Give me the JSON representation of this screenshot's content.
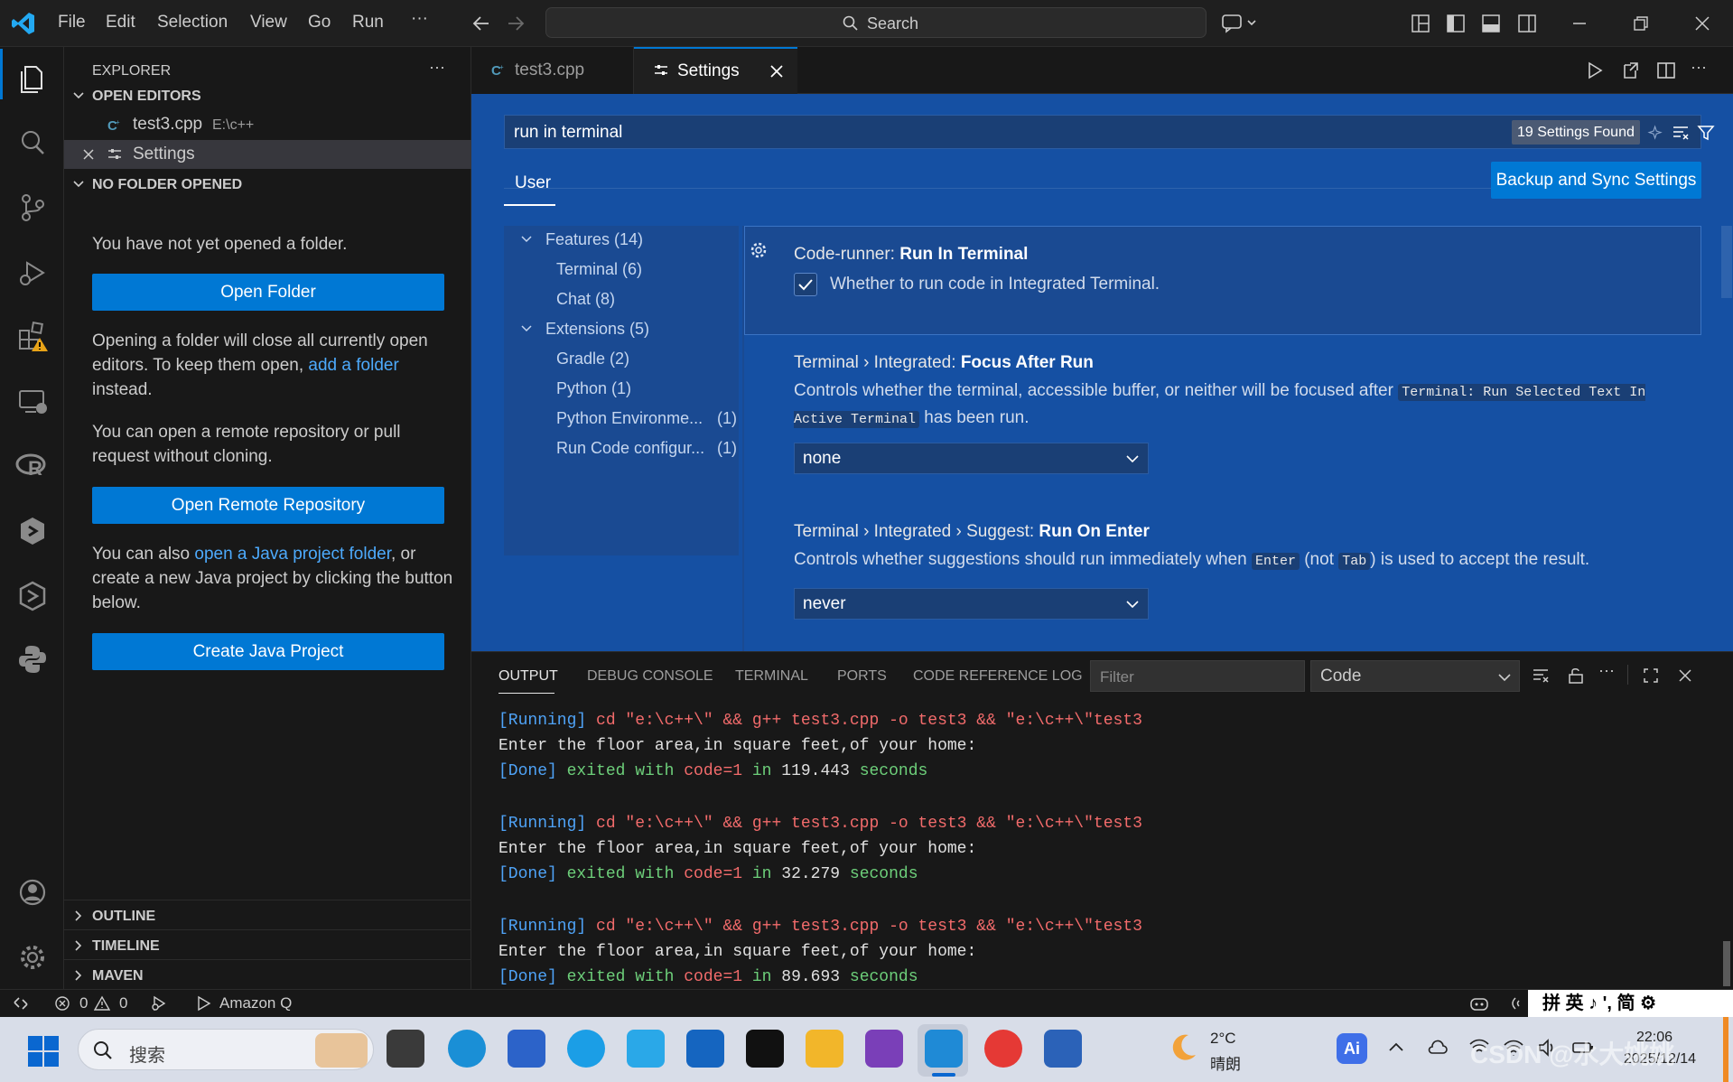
{
  "titlebar": {
    "menu": [
      "File",
      "Edit",
      "Selection",
      "View",
      "Go",
      "Run",
      "···"
    ],
    "search_label": "Search"
  },
  "sidebar": {
    "title": "EXPLORER",
    "open_editors_label": "OPEN EDITORS",
    "open_editors": [
      {
        "name": "test3.cpp",
        "path": "E:\\c++"
      },
      {
        "name": "Settings",
        "path": ""
      }
    ],
    "no_folder_label": "NO FOLDER OPENED",
    "msg1": "You have not yet opened a folder.",
    "open_folder_btn": "Open Folder",
    "msg2_a": "Opening a folder will close all currently open editors. To keep them open, ",
    "msg2_link": "add a folder",
    "msg2_b": " instead.",
    "msg3": "You can open a remote repository or pull request without cloning.",
    "open_remote_btn": "Open Remote Repository",
    "msg4_a": "You can also ",
    "msg4_link": "open a Java project folder",
    "msg4_b": ", or create a new Java project by clicking the button below.",
    "create_java_btn": "Create Java Project",
    "outline_label": "OUTLINE",
    "timeline_label": "TIMELINE",
    "maven_label": "MAVEN"
  },
  "tabs": [
    {
      "label": "test3.cpp",
      "active": false
    },
    {
      "label": "Settings",
      "active": true
    }
  ],
  "settings": {
    "query": "run in terminal",
    "found": "19 Settings Found",
    "scope_tab": "User",
    "backup_btn": "Backup and Sync Settings",
    "toc": [
      {
        "label": "Features (14)",
        "level": 0
      },
      {
        "label": "Terminal (6)",
        "level": 1
      },
      {
        "label": "Chat (8)",
        "level": 1
      },
      {
        "label": "Extensions (5)",
        "level": 0
      },
      {
        "label": "Gradle (2)",
        "level": 1
      },
      {
        "label": "Python (1)",
        "level": 1
      },
      {
        "label": "Python Environme...",
        "count": "(1)",
        "level": 1
      },
      {
        "label": "Run Code configur...",
        "count": "(1)",
        "level": 1
      }
    ],
    "items": [
      {
        "category": "Code-runner: ",
        "name": "Run In Terminal",
        "desc": "Whether to run code in Integrated Terminal.",
        "checked": true
      },
      {
        "category": "Terminal › Integrated: ",
        "name": "Focus After Run",
        "desc_a": "Controls whether the terminal, accessible buffer, or neither will be focused after ",
        "desc_code": "Terminal: Run Selected Text In Active Terminal",
        "desc_b": " has been run.",
        "value": "none"
      },
      {
        "category": "Terminal › Integrated › Suggest: ",
        "name": "Run On Enter",
        "desc_a": "Controls whether suggestions should run immediately when ",
        "desc_code1": "Enter",
        "desc_mid": " (not ",
        "desc_code2": "Tab",
        "desc_b": ") is used to accept the result.",
        "value": "never"
      }
    ]
  },
  "panel": {
    "tabs": [
      "OUTPUT",
      "DEBUG CONSOLE",
      "TERMINAL",
      "PORTS",
      "CODE REFERENCE LOG"
    ],
    "filter_placeholder": "Filter",
    "channel": "Code",
    "runs": [
      {
        "cmd": " cd \"e:\\c++\\\" && g++ test3.cpp -o test3 && \"e:\\c++\\\"test3",
        "prompt": "Enter the floor area,in square feet,of your home:",
        "code": "code=1",
        "time": "119.443"
      },
      {
        "cmd": " cd \"e:\\c++\\\" && g++ test3.cpp -o test3 && \"e:\\c++\\\"test3",
        "prompt": "Enter the floor area,in square feet,of your home:",
        "code": "code=1",
        "time": "32.279"
      },
      {
        "cmd": " cd \"e:\\c++\\\" && g++ test3.cpp -o test3 && \"e:\\c++\\\"test3",
        "prompt": "Enter the floor area,in square feet,of your home:",
        "code": "code=1",
        "time": "89.693"
      }
    ],
    "running_label": "[Running]",
    "done_label": "[Done]",
    "exited_label": " exited with ",
    "in_label": " in ",
    "seconds_label": " seconds"
  },
  "statusbar": {
    "errors": "0",
    "warnings": "0",
    "amazon_q": "Amazon Q",
    "ime": "拼 英 ♪ ', 简 ⚙"
  },
  "taskbar": {
    "search_placeholder": "搜索",
    "weather_temp": "2°C",
    "weather_desc": "晴朗",
    "time": "22:06",
    "date": "2025/12/14",
    "watermark": "CSDN @水大姚姚"
  },
  "colors": {
    "accent": "#0078d4",
    "settings_bg": "#1550a3"
  }
}
